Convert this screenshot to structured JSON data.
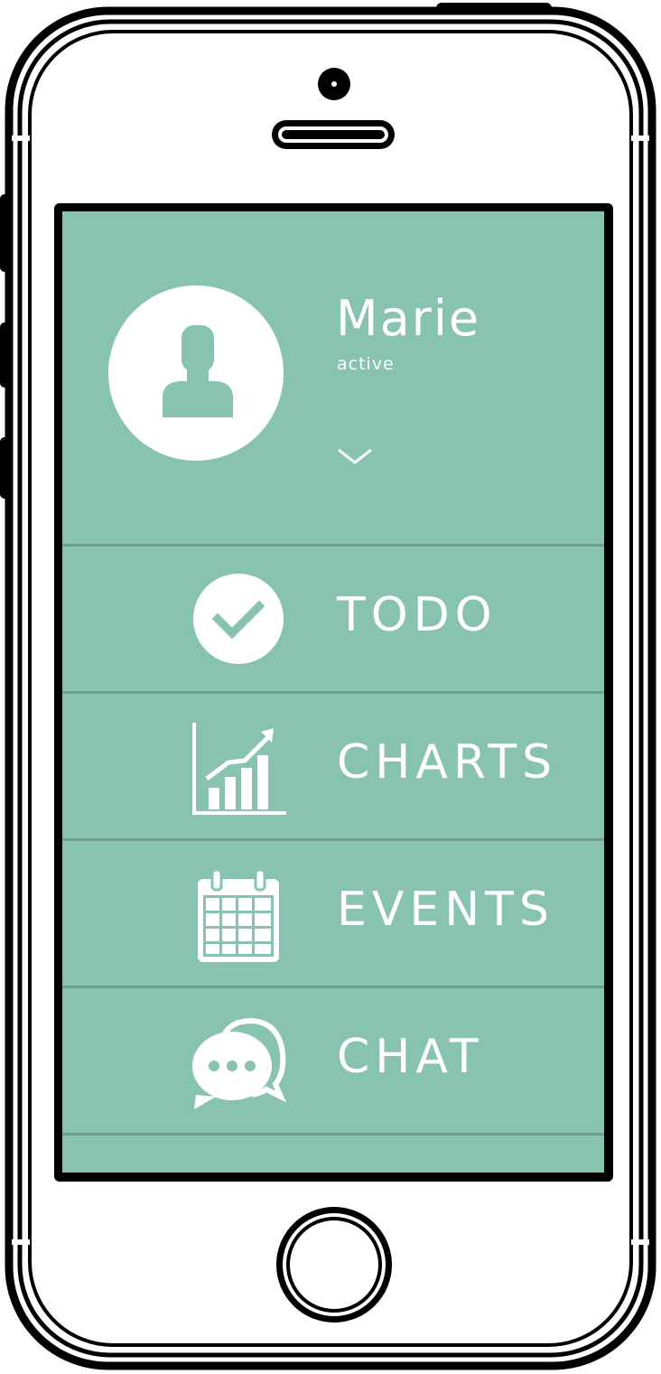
{
  "user": {
    "name": "Marie",
    "status": "active"
  },
  "menu": {
    "items": [
      {
        "label": "TODO",
        "icon": "check-circle-icon"
      },
      {
        "label": "CHARTS",
        "icon": "bar-chart-icon"
      },
      {
        "label": "EVENTS",
        "icon": "calendar-icon"
      },
      {
        "label": "CHAT",
        "icon": "chat-bubbles-icon"
      }
    ]
  },
  "colors": {
    "screen_background": "#88c2b0",
    "divider": "#6f9d8e",
    "foreground": "#ffffff",
    "phone_outline": "#000000"
  }
}
